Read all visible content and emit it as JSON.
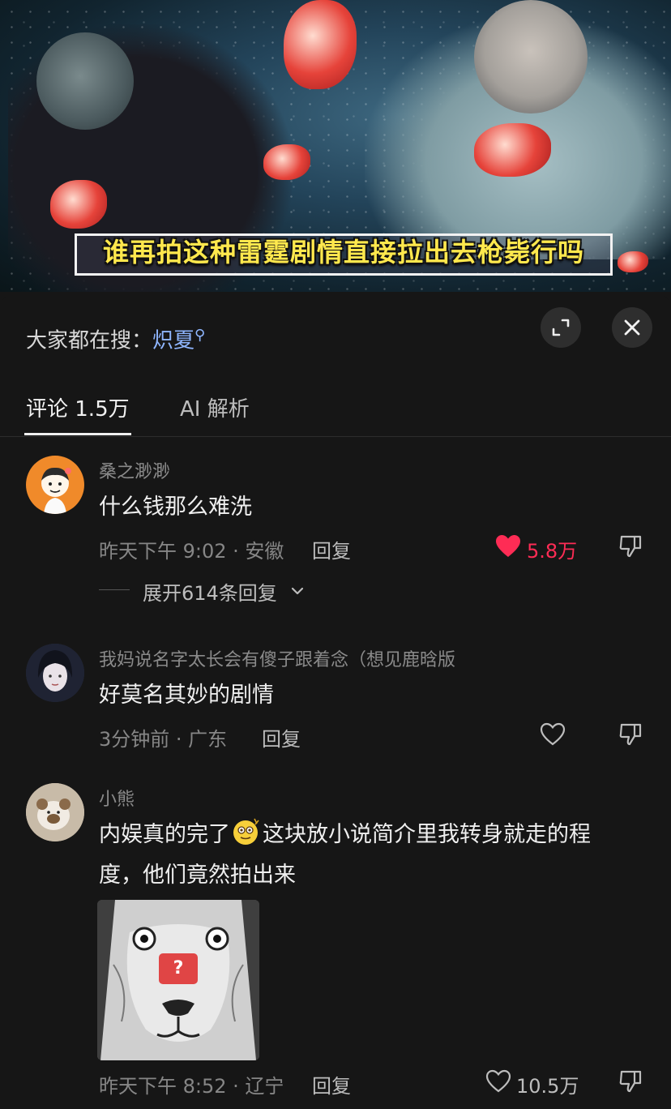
{
  "video": {
    "subtitle": "谁再拍这种雷霆剧情直接拉出去枪毙行吗"
  },
  "search_bar": {
    "prefix": "大家都在搜：",
    "term": "炽夏"
  },
  "tabs": [
    {
      "label": "评论 1.5万",
      "active": true
    },
    {
      "label": "AI 解析",
      "active": false
    }
  ],
  "comments": [
    {
      "username": "桑之渺渺",
      "text": "什么钱那么难洗",
      "time_location": "昨天下午 9:02 · 安徽",
      "reply_label": "回复",
      "likes": "5.8万",
      "liked": true,
      "expand_label": "展开614条回复"
    },
    {
      "username": "我妈说名字太长会有傻子跟着念（想见鹿晗版",
      "text": "好莫名其妙的剧情",
      "time_location": "3分钟前 · 广东",
      "reply_label": "回复",
      "likes": "",
      "liked": false
    },
    {
      "username": "小熊",
      "text_before_emoji": "内娱真的完了",
      "text_after_emoji": "这块放小说简介里我转身就走的程",
      "text_line2": "度，他们竟然拍出来",
      "image_badge": "?",
      "time_location": "昨天下午 8:52 · 辽宁",
      "reply_label": "回复",
      "likes": "10.5万",
      "liked": false
    }
  ],
  "colors": {
    "liked": "#fe2c55",
    "search_term": "#8fb6ff",
    "subtitle": "#ffe84d",
    "background": "#161616"
  }
}
